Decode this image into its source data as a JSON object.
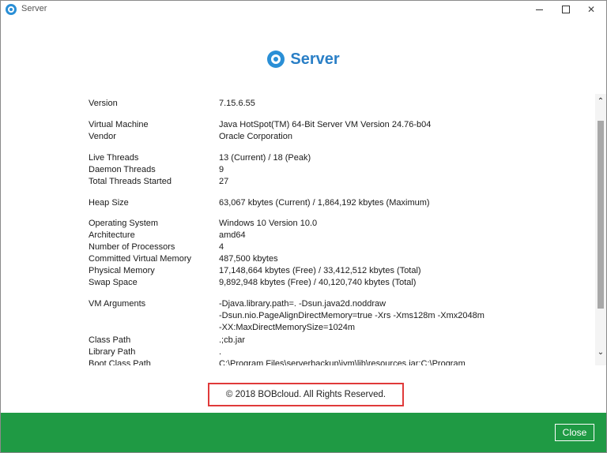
{
  "window": {
    "title": "Server"
  },
  "header": {
    "logo_text": "Server"
  },
  "info": {
    "rows": [
      {
        "label": "Version",
        "value": "7.15.6.55"
      },
      {
        "label": "Virtual Machine",
        "value": "Java HotSpot(TM) 64-Bit Server VM Version 24.76-b04"
      },
      {
        "label": "Vendor",
        "value": "Oracle Corporation"
      },
      {
        "label": "Live Threads",
        "value": "13 (Current) / 18 (Peak)"
      },
      {
        "label": "Daemon Threads",
        "value": "9"
      },
      {
        "label": "Total Threads Started",
        "value": "27"
      },
      {
        "label": "Heap Size",
        "value": "63,067 kbytes (Current) / 1,864,192 kbytes (Maximum)"
      },
      {
        "label": "Operating System",
        "value": "Windows 10 Version 10.0"
      },
      {
        "label": "Architecture",
        "value": "amd64"
      },
      {
        "label": "Number of Processors",
        "value": "4"
      },
      {
        "label": "Committed Virtual Memory",
        "value": "487,500 kbytes"
      },
      {
        "label": "Physical Memory",
        "value": "17,148,664 kbytes (Free) / 33,412,512 kbytes (Total)"
      },
      {
        "label": "Swap Space",
        "value": "9,892,948 kbytes (Free) / 40,120,740 kbytes (Total)"
      },
      {
        "label": "VM Arguments",
        "value": "-Djava.library.path=. -Dsun.java2d.noddraw"
      },
      {
        "label": "",
        "value": "-Dsun.nio.PageAlignDirectMemory=true -Xrs -Xms128m -Xmx2048m"
      },
      {
        "label": "",
        "value": "-XX:MaxDirectMemorySize=1024m"
      },
      {
        "label": "Class Path",
        "value": ".;cb.jar"
      },
      {
        "label": "Library Path",
        "value": "."
      },
      {
        "label": "Boot Class Path",
        "value": "C:\\Program Files\\serverbackup\\jvm\\lib\\resources.jar;C:\\Program"
      }
    ]
  },
  "copyright": "© 2018 BOBcloud. All Rights Reserved.",
  "footer": {
    "close_label": "Close"
  },
  "icons": {
    "app": "app-logo-icon",
    "scroll_up": "chevron-up-icon",
    "scroll_down": "chevron-down-icon"
  },
  "colors": {
    "brand_blue": "#2a8fd6",
    "footer_green": "#1f9a44",
    "highlight_red": "#e03a3a"
  }
}
